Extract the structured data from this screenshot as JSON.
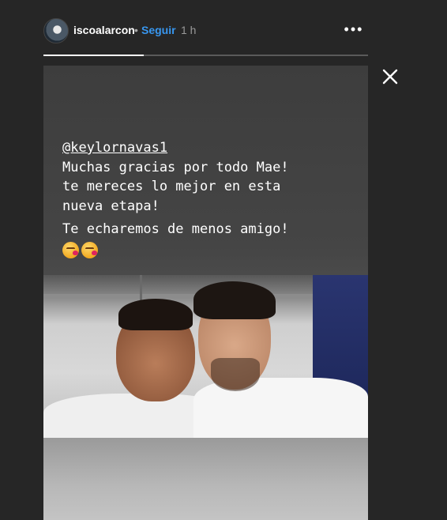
{
  "header": {
    "username": "iscoalarcon",
    "separator": "•",
    "follow_label": "Seguir",
    "time": "1 h",
    "more_icon": "more-horizontal-icon",
    "more_glyph": "•••",
    "close_icon": "close-icon",
    "avatar_icon": "profile-avatar"
  },
  "progress": {
    "fraction": 0.31,
    "segments": 1
  },
  "story": {
    "mention": "@keylornavas1",
    "lines": [
      "Muchas gracias por todo Mae!",
      "te mereces lo mejor en esta",
      "nueva etapa!"
    ],
    "line2": "Te echaremos de menos amigo!",
    "emojis": [
      "kissing-face-icon",
      "kissing-face-icon"
    ],
    "photo": "two-players-selfie"
  },
  "colors": {
    "background": "#262626",
    "follow": "#3897f0",
    "text": "#ffffff"
  }
}
